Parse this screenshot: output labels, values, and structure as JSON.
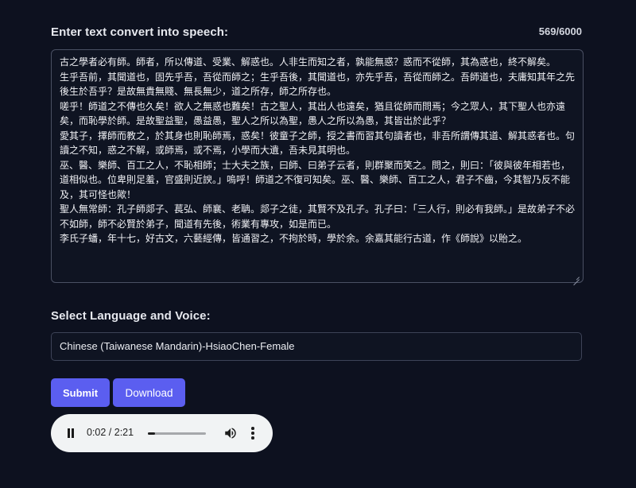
{
  "text_section": {
    "label": "Enter text convert into speech:",
    "char_count": "569/6000",
    "value": "古之學者必有師。師者，所以傳道、受業、解惑也。人非生而知之者，孰能無惑？惑而不從師，其為惑也，終不解矣。\n生乎吾前，其聞道也，固先乎吾，吾從而師之；生乎吾後，其聞道也，亦先乎吾，吾從而師之。吾師道也，夫庸知其年之先後生於吾乎？是故無貴無賤、無長無少，道之所存，師之所存也。\n嗟乎！師道之不傳也久矣！欲人之無惑也難矣！古之聖人，其出人也遠矣，猶且從師而問焉；今之眾人，其下聖人也亦遠矣，而恥學於師。是故聖益聖，愚益愚，聖人之所以為聖，愚人之所以為愚，其皆出於此乎？\n愛其子，擇師而教之，於其身也則恥師焉，惑矣！彼童子之師，授之書而習其句讀者也，非吾所謂傳其道、解其惑者也。句讀之不知，惑之不解，或師焉，或不焉，小學而大遺，吾未見其明也。\n巫、醫、樂師、百工之人，不恥相師；士大夫之族，曰師、曰弟子云者，則群聚而笑之。問之，則曰：「彼與彼年相若也，道相似也。位卑則足羞，官盛則近諛。」嗚呼！師道之不復可知矣。巫、醫、樂師、百工之人，君子不齒，今其智乃反不能及，其可怪也歟！\n聖人無常師：孔子師郯子、萇弘、師襄、老聃。郯子之徒，其賢不及孔子。孔子曰：「三人行，則必有我師。」是故弟子不必不如師，師不必賢於弟子，聞道有先後，術業有專攻，如是而已。\n李氏子蟠，年十七，好古文，六藝經傳，皆通習之，不拘於時，學於余。余嘉其能行古道，作《師說》以貽之。"
  },
  "voice_section": {
    "label": "Select Language and Voice:",
    "selected_voice": "Chinese (Taiwanese Mandarin)-HsiaoChen-Female"
  },
  "buttons": {
    "submit_label": "Submit",
    "download_label": "Download"
  },
  "audio_player": {
    "time": "0:02 / 2:21",
    "progress_fraction": 0.0142,
    "icons": [
      "pause-icon",
      "volume-icon",
      "more-options-icon"
    ]
  },
  "colors": {
    "background": "#0d111f",
    "accent": "#5b5ef0",
    "player_bg": "#f1f3f4"
  }
}
